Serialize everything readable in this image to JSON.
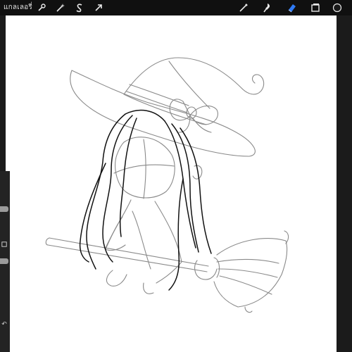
{
  "topbar": {
    "gallery_label": "แกลเลอรี่",
    "left_tools": [
      "wrench-icon",
      "magic-wand-icon",
      "selection-icon",
      "transform-arrow-icon"
    ],
    "right_tools": [
      "brush-icon",
      "smudge-icon",
      "eraser-icon",
      "layers-icon",
      "color-swatch-icon"
    ],
    "colors": {
      "background": "#101010",
      "active_tool": "#2f7bf6",
      "icon": "#e8e8e8",
      "color_swatch": "#1a1a1a"
    }
  },
  "sidebar": {
    "controls": [
      "brush-size-slider",
      "modify-button",
      "opacity-slider",
      "undo-button"
    ],
    "undo_glyph": "↶"
  },
  "canvas": {
    "background": "#ffffff",
    "artwork": "witch-on-broom-sketch",
    "line_colors": {
      "guide": "#8a8a8a",
      "ink": "#111111"
    }
  }
}
